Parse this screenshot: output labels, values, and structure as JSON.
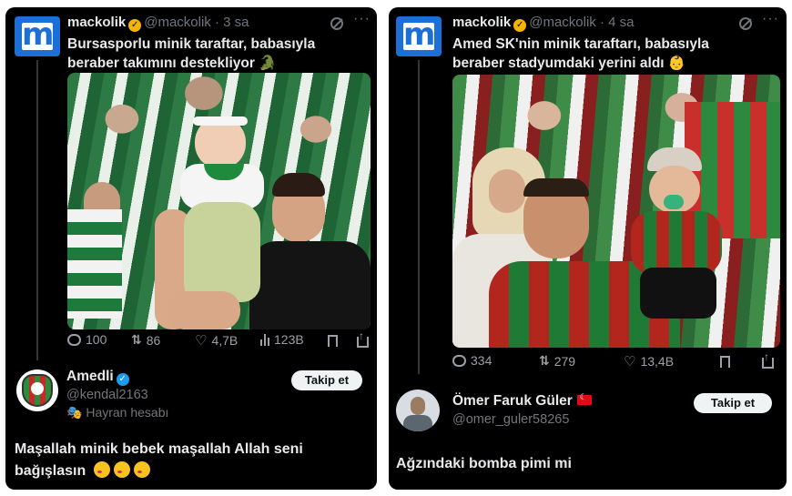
{
  "left_post": {
    "author": {
      "name": "mackolik",
      "handle": "@mackolik",
      "time": "· 3 sa",
      "avatar_letter": "m"
    },
    "text": "Bursasporlu minik taraftar, babasıyla beraber takımını destekliyor 🐊",
    "stats": {
      "replies": "100",
      "reposts": "86",
      "likes": "4,7B",
      "views": "123B"
    },
    "reply": {
      "name": "Amedli",
      "handle": "@kendal2163",
      "tag": "Hayran hesabı",
      "follow_label": "Takip et",
      "text": "Maşallah minik bebek maşallah Allah seni bağışlasın"
    }
  },
  "right_post": {
    "author": {
      "name": "mackolik",
      "handle": "@mackolik",
      "time": "· 4 sa",
      "avatar_letter": "m"
    },
    "text": "Amed SK'nin minik taraftarı, babasıyla beraber stadyumdaki yerini aldı 👶",
    "stats": {
      "replies": "334",
      "reposts": "279",
      "likes": "13,4B"
    },
    "reply": {
      "name": "Ömer Faruk Güler",
      "handle": "@omer_guler58265",
      "follow_label": "Takip et",
      "text": "Ağzındaki bomba pimi mi"
    }
  },
  "icons": {
    "verified_badge": "verified-badge-icon",
    "grok": "grok-icon",
    "more": "more-icon",
    "reply": "reply-icon",
    "repost": "repost-icon",
    "like": "like-icon",
    "views": "views-icon",
    "bookmark": "bookmark-icon",
    "share": "share-icon"
  },
  "colors": {
    "background": "#000000",
    "text": "#e7e9ea",
    "secondary": "#71767b",
    "brand_blue": "#1d6fd8",
    "follow_button": "#eff3f4"
  }
}
